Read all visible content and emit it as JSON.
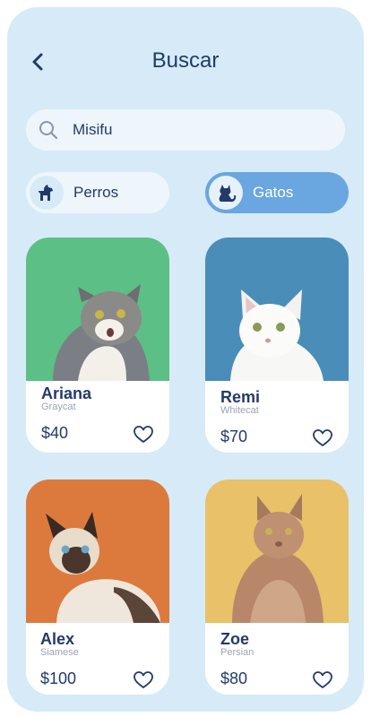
{
  "header": {
    "title": "Buscar",
    "back_icon": "chevron-left-icon"
  },
  "search": {
    "value": "Misifu",
    "placeholder": "",
    "icon": "search-icon"
  },
  "categories": [
    {
      "label": "Perros",
      "icon": "dog-icon",
      "selected": false
    },
    {
      "label": "Gatos",
      "icon": "cat-icon",
      "selected": true
    }
  ],
  "pets": [
    {
      "name": "Ariana",
      "breed": "Graycat",
      "price": "$40",
      "bg": "#5cbf86"
    },
    {
      "name": "Remi",
      "breed": "Whitecat",
      "price": "$70",
      "bg": "#4a8db8"
    },
    {
      "name": "Alex",
      "breed": "Siamese",
      "price": "$100",
      "bg": "#dc7a3e"
    },
    {
      "name": "Zoe",
      "breed": "Persian",
      "price": "$80",
      "bg": "#e8c168"
    }
  ],
  "colors": {
    "background": "#d6ebf7",
    "primary_text": "#223a6b",
    "selected_chip": "#6aa6e0",
    "chip": "#eef6fb"
  }
}
